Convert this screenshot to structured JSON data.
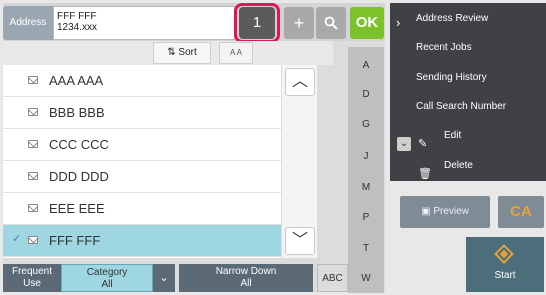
{
  "address": {
    "label": "Address",
    "line1": "FFF FFF",
    "line2": "1234.xxx"
  },
  "toolbar": {
    "count": "1",
    "plus": "+",
    "ok": "OK"
  },
  "sortbar": {
    "sort_label": "Sort",
    "az_label": "A A"
  },
  "contacts": [
    "AAA AAA",
    "BBB BBB",
    "CCC CCC",
    "DDD DDD",
    "EEE EEE",
    "FFF FFF"
  ],
  "selected_contact": "FFF FFF",
  "index_letters": [
    "A",
    "D",
    "G",
    "J",
    "M",
    "P",
    "T",
    "W"
  ],
  "bottom": {
    "frequent": "Frequent Use",
    "category_title": "Category",
    "category_value": "All",
    "narrow_title": "Narrow Down",
    "narrow_value": "All",
    "abc": "ABC"
  },
  "menu": {
    "items": [
      "Address Review",
      "Recent Jobs",
      "Sending History",
      "Call Search Number",
      "Edit",
      "Delete"
    ]
  },
  "actions": {
    "preview": "Preview",
    "ca": "CA",
    "start": "Start"
  },
  "colors": {
    "ok": "#7cc22b",
    "highlight_ring": "#e0145c",
    "selected_row": "#9ed7e2",
    "ca": "#e6a23c"
  }
}
